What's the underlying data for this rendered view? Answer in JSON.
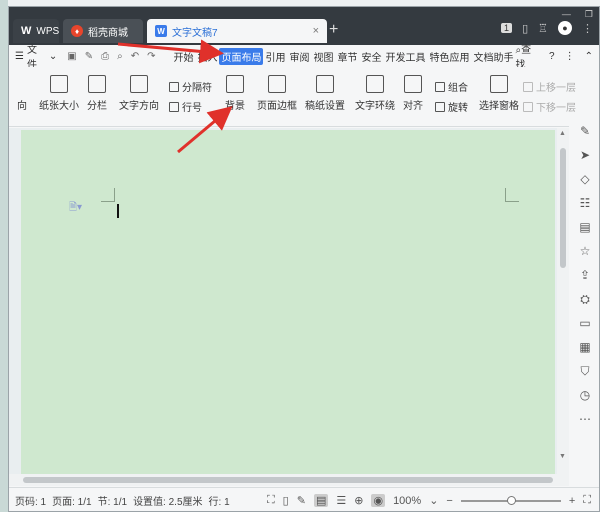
{
  "tabs": [
    {
      "label": "WPS",
      "icon": "wps-logo-icon"
    },
    {
      "label": "稻壳商城",
      "icon": "daoke-flame-icon"
    },
    {
      "label": "文字文稿7",
      "icon": "document-icon",
      "close": "×"
    }
  ],
  "new_tab": "+",
  "badge_count": "1",
  "menu": {
    "file": "文件",
    "items": [
      "开始",
      "插入",
      "页面布局",
      "引用",
      "审阅",
      "视图",
      "章节",
      "安全",
      "开发工具",
      "特色应用",
      "文档助手"
    ],
    "active": "页面布局",
    "search": "查找",
    "help": "?"
  },
  "ribbon": {
    "orientation_partial": "向",
    "paper_size": "纸张大小",
    "columns": "分栏",
    "text_direction": "文字方向",
    "separator": "分隔符",
    "line_number": "行号",
    "background": "背景",
    "page_border": "页面边框",
    "manuscript": "稿纸设置",
    "text_wrap": "文字环绕",
    "align": "对齐",
    "group": "组合",
    "rotate": "旋转",
    "selection_pane": "选择窗格",
    "bring_forward": "上移一层",
    "send_backward": "下移一层"
  },
  "status": {
    "page_num": "页码: 1",
    "pages": "页面: 1/1",
    "section": "节: 1/1",
    "setting": "设置值: 2.5厘米",
    "row": "行: 1",
    "zoom": "100%",
    "zoom_fraction": 0.5
  },
  "colors": {
    "page_background": "#cfe8cf",
    "active_menu": "#3a7bea",
    "arrow": "#e0312b"
  }
}
